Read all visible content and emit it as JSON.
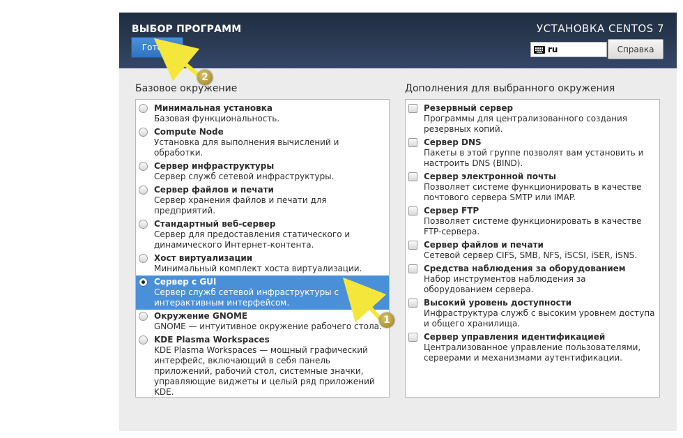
{
  "header": {
    "title": "ВЫБОР ПРОГРАММ",
    "done_label": "Готово",
    "installer_title": "УСТАНОВКА CENTOS 7",
    "keyboard_layout": "ru",
    "help_label": "Справка"
  },
  "base_env": {
    "label": "Базовое окружение",
    "items": [
      {
        "name": "Минимальная установка",
        "desc": "Базовая функциональность."
      },
      {
        "name": "Compute Node",
        "desc": "Установка для выполнения вычислений и обработки."
      },
      {
        "name": "Сервер инфраструктуры",
        "desc": "Сервер служб сетевой инфраструктуры."
      },
      {
        "name": "Сервер файлов и печати",
        "desc": "Сервер хранения файлов и печати для предприятий."
      },
      {
        "name": "Стандартный веб-сервер",
        "desc": "Сервер для предоставления статического и динамического Интернет-контента."
      },
      {
        "name": "Хост виртуализации",
        "desc": "Минимальный комплект хоста виртуализации."
      },
      {
        "name": "Сервер с GUI",
        "desc": "Сервер служб сетевой инфраструктуры с интерактивным интерфейсом."
      },
      {
        "name": "Окружение GNOME",
        "desc": "GNOME — интуитивное окружение рабочего стола."
      },
      {
        "name": "KDE Plasma Workspaces",
        "desc": "KDE Plasma Workspaces — мощный графический интерфейс, включающий в себя панель приложений, рабочий стол, системные значки, управляющие виджеты и целый ряд приложений KDE."
      }
    ],
    "selected_index": 6
  },
  "addons": {
    "label": "Дополнения для выбранного окружения",
    "items": [
      {
        "name": "Резервный сервер",
        "desc": "Программы для централизованного создания резервных копий."
      },
      {
        "name": "Сервер DNS",
        "desc": "Пакеты в этой группе позволят вам установить и настроить DNS (BIND)."
      },
      {
        "name": "Сервер электронной почты",
        "desc": "Позволяет системе функционировать в качестве почтового сервера SMTP или IMAP."
      },
      {
        "name": "Сервер FTP",
        "desc": "Позволяет системе функционировать в качестве FTP-сервера."
      },
      {
        "name": "Сервер файлов и печати",
        "desc": "Сетевой сервер CIFS, SMB, NFS, iSCSI, iSER, iSNS."
      },
      {
        "name": "Средства наблюдения за оборудованием",
        "desc": "Набор инструментов наблюдения за оборудованием сервера."
      },
      {
        "name": "Высокий уровень доступности",
        "desc": "Инфраструктура служб с высоким уровнем доступа и общего хранилища."
      },
      {
        "name": "Сервер управления идентификацией",
        "desc": "Централизованное управление пользователями, серверами и механизмами аутентификации."
      }
    ]
  },
  "annotations": {
    "badge_1": "1",
    "badge_2": "2",
    "arrow_color": "#f5e63b"
  },
  "colors": {
    "header_bg": "#2c3c55",
    "accent": "#4a90d9",
    "window_bg": "#ececec"
  }
}
